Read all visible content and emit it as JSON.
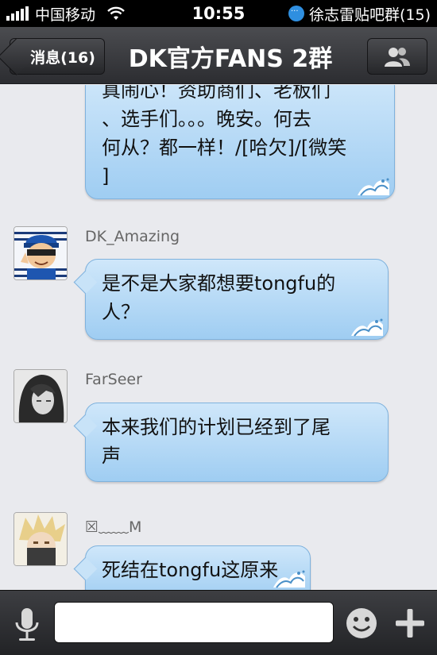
{
  "status_bar": {
    "carrier": "中国移动",
    "time": "10:55",
    "notification": "徐志雷贴吧群(15)"
  },
  "nav": {
    "back_label": "消息(16)",
    "title": "DK官方FANS 2群",
    "members_icon": "people-icon"
  },
  "messages": [
    {
      "sender": "",
      "lines": [
        "真闹心！资助商们、老板们",
        "、选手们。。。晚安。何去",
        "何从？都一样！/[哈欠]/[微笑",
        "]"
      ]
    },
    {
      "sender": "DK_Amazing",
      "lines": [
        "是不是大家都想要tongfu的",
        "人？"
      ]
    },
    {
      "sender": "FarSeer",
      "lines": [
        "本来我们的计划已经到了尾",
        "声"
      ]
    },
    {
      "sender": "☒﹏﹏M",
      "lines": [
        "死结在tongfu这原来"
      ]
    }
  ],
  "input": {
    "placeholder": "",
    "icons": [
      "microphone-icon",
      "emoji-icon",
      "plus-icon"
    ]
  },
  "colors": {
    "bubble": "#a9d3f5",
    "navbar": "#3a3b3f",
    "background": "#e9eaee"
  }
}
